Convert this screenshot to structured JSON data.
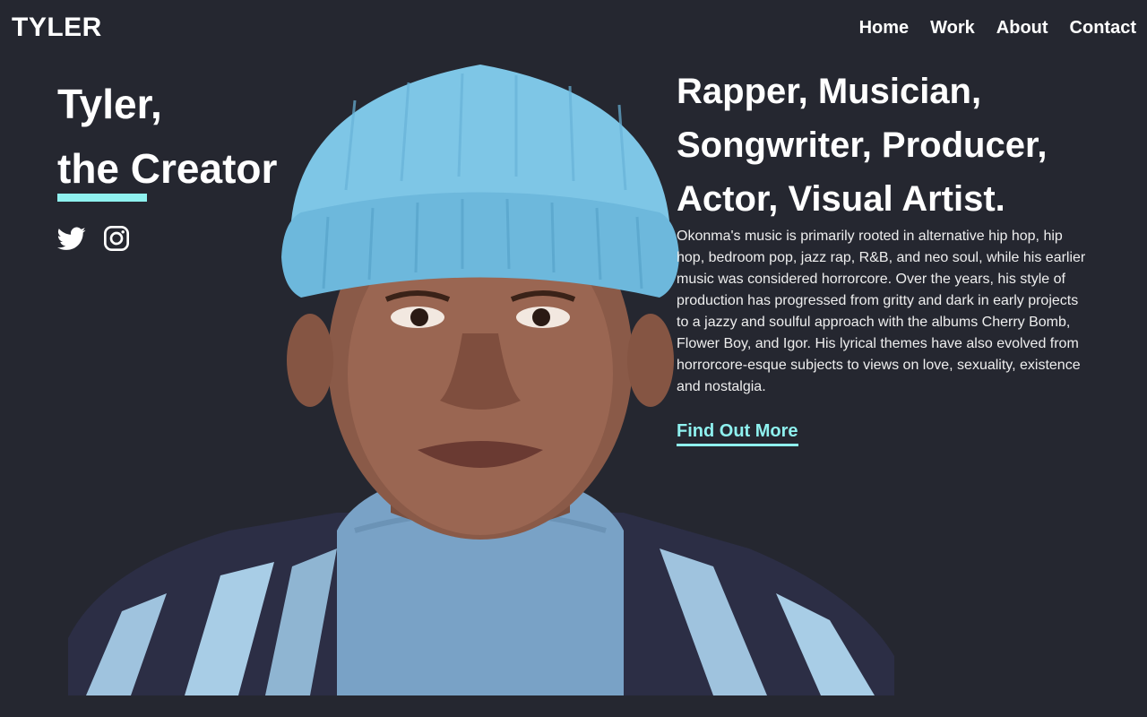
{
  "header": {
    "logo": "TYLER",
    "nav": [
      "Home",
      "Work",
      "About",
      "Contact"
    ]
  },
  "hero": {
    "title_line1": "Tyler,",
    "title_line2": "the Creator",
    "social_icons": [
      "twitter-icon",
      "instagram-icon"
    ],
    "roles": [
      "Rapper, Musician,",
      "Songwriter, Producer,",
      "Actor, Visual Artist."
    ],
    "bio": "Okonma's music is primarily rooted in alternative hip hop, hip hop, bedroom pop, jazz rap, R&B, and neo soul, while his earlier music was considered horrorcore. Over the years, his style of production has progressed from gritty and dark in early projects to a jazzy and soulful approach with the albums Cherry Bomb, Flower Boy, and Igor. His lyrical themes have also evolved from horrorcore-esque subjects to views on love, sexuality, existence and nostalgia.",
    "cta_label": "Find Out More"
  },
  "colors": {
    "background": "#252730",
    "accent": "#8ff1ef",
    "text": "#ffffff"
  }
}
